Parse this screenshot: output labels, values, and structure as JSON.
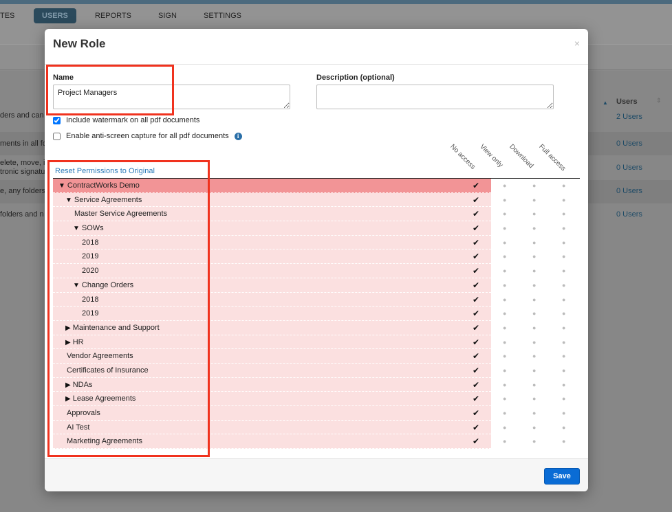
{
  "nav": {
    "tabs": [
      {
        "label": "TES"
      },
      {
        "label": "USERS"
      },
      {
        "label": "REPORTS"
      },
      {
        "label": "SIGN"
      },
      {
        "label": "SETTINGS"
      }
    ]
  },
  "background": {
    "users_header": "Users",
    "rows": [
      {
        "fragment": "ders and can",
        "users": "2 Users"
      },
      {
        "fragment": "ments in all fol",
        "users": "0 Users"
      },
      {
        "fragment": "elete, move, i",
        "fragment2": "tronic signatu",
        "users": "0 Users"
      },
      {
        "fragment": "e, any folders",
        "users": "0 Users"
      },
      {
        "fragment": " folders and n",
        "users": "0 Users"
      }
    ]
  },
  "modal": {
    "title": "New Role",
    "close": "×",
    "name_label": "Name",
    "name_value": "Project Managers",
    "description_label": "Description (optional)",
    "description_value": "",
    "watermark_label": "Include watermark on all pdf documents",
    "watermark_checked": true,
    "anticapture_label": "Enable anti-screen capture for all pdf documents",
    "anticapture_checked": false,
    "info_icon": "i",
    "reset_link": "Reset Permissions to Original",
    "columns": [
      "No access",
      "View only",
      "Download",
      "Full access"
    ],
    "check_glyph": "✔",
    "dot_glyph": "●",
    "tree": [
      {
        "label": "ContractWorks Demo",
        "level": 0,
        "caret": "▼"
      },
      {
        "label": "Service Agreements",
        "level": 1,
        "caret": "▼"
      },
      {
        "label": "Master Service Agreements",
        "level": 2,
        "caret": ""
      },
      {
        "label": "SOWs",
        "level": 2,
        "caret": "▼"
      },
      {
        "label": "2018",
        "level": 3,
        "caret": ""
      },
      {
        "label": "2019",
        "level": 3,
        "caret": ""
      },
      {
        "label": "2020",
        "level": 3,
        "caret": ""
      },
      {
        "label": "Change Orders",
        "level": 2,
        "caret": "▼"
      },
      {
        "label": "2018",
        "level": 3,
        "caret": ""
      },
      {
        "label": "2019",
        "level": 3,
        "caret": ""
      },
      {
        "label": "Maintenance and Support",
        "level": 1,
        "caret": "▶"
      },
      {
        "label": "HR",
        "level": 1,
        "caret": "▶"
      },
      {
        "label": "Vendor Agreements",
        "level": 1,
        "caret": ""
      },
      {
        "label": "Certificates of Insurance",
        "level": 1,
        "caret": ""
      },
      {
        "label": "NDAs",
        "level": 1,
        "caret": "▶"
      },
      {
        "label": "Lease Agreements",
        "level": 1,
        "caret": "▶"
      },
      {
        "label": "Approvals",
        "level": 1,
        "caret": ""
      },
      {
        "label": "AI Test",
        "level": 1,
        "caret": ""
      },
      {
        "label": "Marketing Agreements",
        "level": 1,
        "caret": ""
      }
    ],
    "save_label": "Save"
  },
  "colors": {
    "accent": "#0a6cd5",
    "root_row": "#f29496",
    "row": "#fbe0e0",
    "annotation": "#f0321e",
    "link": "#2a7ab8"
  }
}
